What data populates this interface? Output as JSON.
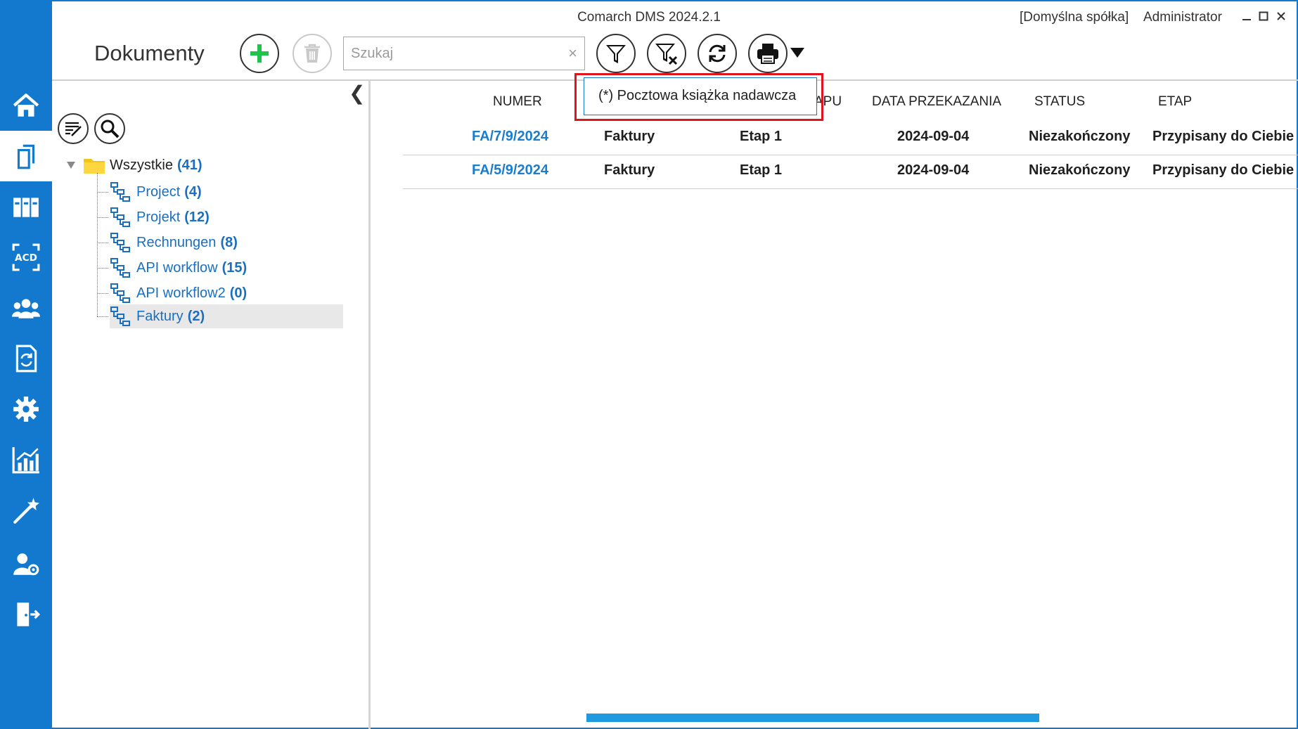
{
  "window": {
    "title": "Comarch DMS 2024.2.1",
    "company": "[Domyślna spółka]",
    "user": "Administrator"
  },
  "toolbar": {
    "page_title": "Dokumenty",
    "search_placeholder": "Szukaj",
    "search_clear": "×"
  },
  "nav": {
    "items": [
      "home-icon",
      "documents-icon",
      "binders-icon",
      "ocr-acd-icon",
      "users-icon",
      "document-sync-icon",
      "settings-gear-icon",
      "reports-chart-icon",
      "wizard-wand-icon",
      "user-settings-icon",
      "logout-door-icon"
    ],
    "active": "documents-icon"
  },
  "tree": {
    "collapse_glyph": "❮",
    "root": {
      "label": "Wszystkie",
      "count": "(41)"
    },
    "items": [
      {
        "label": "Project",
        "count": "(4)"
      },
      {
        "label": "Projekt",
        "count": "(12)"
      },
      {
        "label": "Rechnungen",
        "count": "(8)"
      },
      {
        "label": "API workflow",
        "count": "(15)"
      },
      {
        "label": "API workflow2",
        "count": "(0)"
      },
      {
        "label": "Faktury",
        "count": "(2)"
      }
    ],
    "selected": "Faktury"
  },
  "grid": {
    "columns": [
      "NUMER",
      "APU",
      "DATA PRZEKAZANIA",
      "STATUS",
      "ETAP"
    ],
    "rows": [
      {
        "numer": "FA/7/9/2024",
        "typ": "Faktury",
        "etap_nazwa": "Etap 1",
        "data": "2024-09-04",
        "status": "Niezakończony",
        "etap": "Przypisany do Ciebie"
      },
      {
        "numer": "FA/5/9/2024",
        "typ": "Faktury",
        "etap_nazwa": "Etap 1",
        "data": "2024-09-04",
        "status": "Niezakończony",
        "etap": "Przypisany do Ciebie"
      }
    ]
  },
  "print_menu": {
    "item": "(*) Pocztowa książka nadawcza"
  },
  "colors": {
    "nav_blue": "#1279cf",
    "link_blue": "#1a7dd0",
    "highlight_red": "#e0141e",
    "add_green": "#1fc24b",
    "scrollbar_blue": "#1e9be0"
  }
}
